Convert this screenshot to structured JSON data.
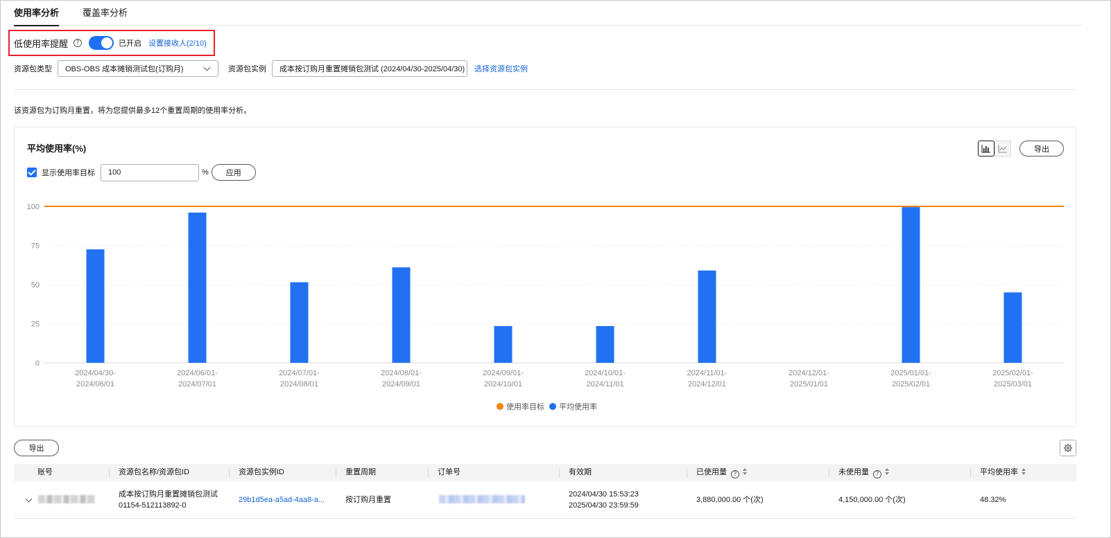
{
  "tabs": [
    {
      "label": "使用率分析",
      "active": true
    },
    {
      "label": "覆盖率分析",
      "active": false
    }
  ],
  "alert": {
    "label": "低使用率提醒",
    "toggle_on": true,
    "toggle_text": "已开启",
    "receivers_link": "设置接收人(2/10)"
  },
  "filters": {
    "type_label": "资源包类型",
    "type_value": "OBS-OBS 成本摊销测试包(订购月)",
    "instance_label": "资源包实例",
    "instance_value": "成本按订购月重置摊销包测试 (2024/04/30-2025/04/30)",
    "select_instance_link": "选择资源包实例"
  },
  "info_text": "该资源包为订购月重置，将为您提供最多12个重置周期的使用率分析。",
  "chart_card": {
    "title": "平均使用率(%)",
    "export_label": "导出",
    "show_target_label": "显示使用率目标",
    "target_value": "100",
    "percent_sign": "%",
    "apply_label": "应用",
    "active_chart_type": "bar",
    "chart_type_icons": [
      "bar-chart-icon",
      "line-chart-icon"
    ]
  },
  "chart_data": {
    "type": "bar",
    "title": "平均使用率(%)",
    "categories": [
      [
        "2024/04/30-",
        "2024/06/01"
      ],
      [
        "2024/06/01-",
        "2024/07/01"
      ],
      [
        "2024/07/01-",
        "2024/08/01"
      ],
      [
        "2024/08/01-",
        "2024/09/01"
      ],
      [
        "2024/09/01-",
        "2024/10/01"
      ],
      [
        "2024/10/01-",
        "2024/11/01"
      ],
      [
        "2024/11/01-",
        "2024/12/01"
      ],
      [
        "2024/12/01-",
        "2025/01/01"
      ],
      [
        "2025/01/01-",
        "2025/02/01"
      ],
      [
        "2025/02/01-",
        "2025/03/01"
      ]
    ],
    "series": [
      {
        "name": "平均使用率",
        "color": "#2271f2",
        "values": [
          72.5,
          96,
          51.5,
          61,
          23.5,
          23.5,
          59,
          0,
          99.5,
          45
        ]
      }
    ],
    "target": {
      "name": "使用率目标",
      "value": 100,
      "color": "#f5830c"
    },
    "ylim": [
      0,
      100
    ],
    "yticks": [
      0,
      25,
      50,
      75,
      100
    ],
    "grid": true,
    "legend_position": "bottom-center"
  },
  "table": {
    "export_label": "导出",
    "columns": [
      "账号",
      "资源包名称/资源包ID",
      "资源包实例ID",
      "重置周期",
      "订单号",
      "有效期",
      "已使用量",
      "未使用量",
      "平均使用率"
    ],
    "rows": [
      {
        "name_line1": "成本按订购月重置摊销包测试",
        "name_line2": "01154-512113892-0",
        "instance_id": "29b1d5ea-a5ad-4aa8-a...",
        "reset_cycle": "按订购月重置",
        "validity_start": "2024/04/30 15:53:23",
        "validity_end": "2025/04/30 23:59:59",
        "used": "3,880,000.00 个(次)",
        "unused": "4,150,000.00 个(次)",
        "avg_rate": "48.32%"
      }
    ]
  }
}
